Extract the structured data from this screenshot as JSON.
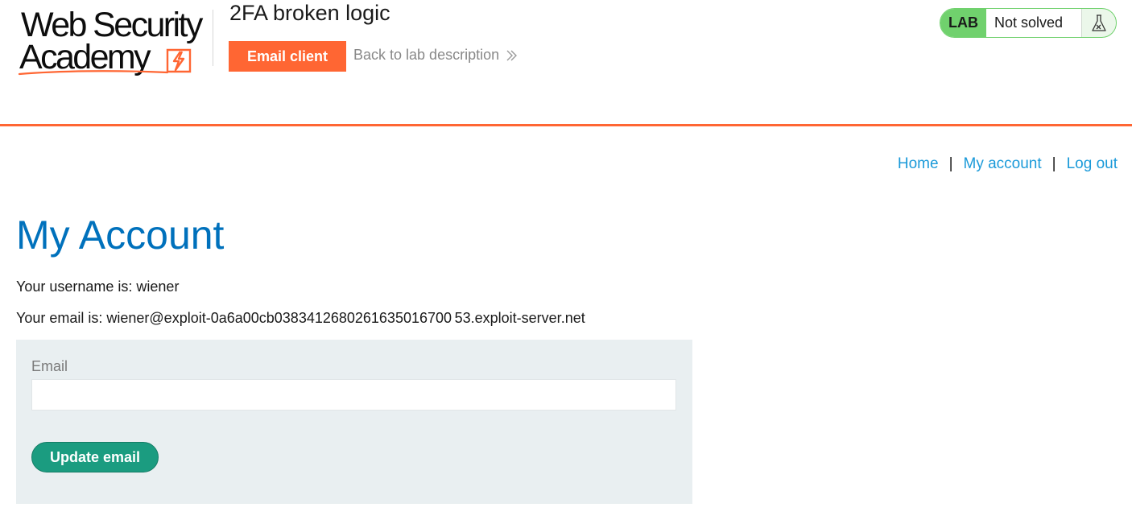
{
  "brand": {
    "logo_line1": "Web Security",
    "logo_line2": "Academy",
    "accent_color": "#ff6633"
  },
  "header": {
    "lab_title": "2FA broken logic",
    "email_client_label": "Email client",
    "back_link_label": "Back to lab description",
    "lab_badge": "LAB",
    "lab_status": "Not solved",
    "status_color": "#70d16d"
  },
  "nav": {
    "home": "Home",
    "my_account": "My account",
    "log_out": "Log out",
    "separator": "|"
  },
  "main": {
    "title": "My Account",
    "username_line": "Your username is: wiener",
    "email_line": "Your email is: wiener@exploit-0a6a00cb0383412680261635016700 53.exploit-server.net",
    "form": {
      "email_label": "Email",
      "email_value": "",
      "email_placeholder": "",
      "submit_label": "Update email"
    }
  },
  "icons": {
    "logo_bolt": "lightning-bolt-icon",
    "back_chevron": "double-chevron-right-icon",
    "flask": "flask-icon"
  }
}
